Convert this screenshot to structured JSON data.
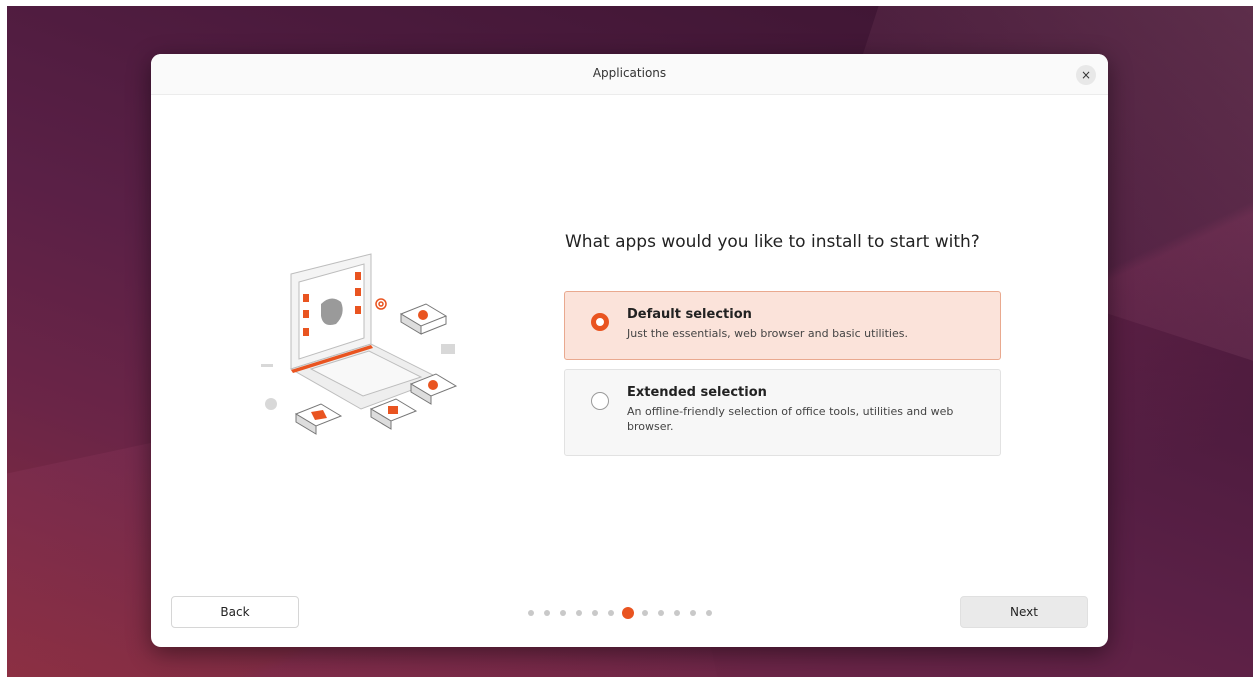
{
  "window": {
    "title": "Applications",
    "close_label": "×"
  },
  "page": {
    "question": "What apps would you like to install to start with?",
    "options": [
      {
        "title": "Default selection",
        "description": "Just the essentials, web browser and basic utilities.",
        "selected": true
      },
      {
        "title": "Extended selection",
        "description": "An offline-friendly selection of office tools, utilities and web browser.",
        "selected": false
      }
    ]
  },
  "footer": {
    "back_label": "Back",
    "next_label": "Next",
    "step_total": 12,
    "step_current": 7
  },
  "colors": {
    "accent": "#e95420",
    "selected_bg": "#fbe3da"
  },
  "icons": [
    "close-icon",
    "laptop-apps-illustration"
  ]
}
